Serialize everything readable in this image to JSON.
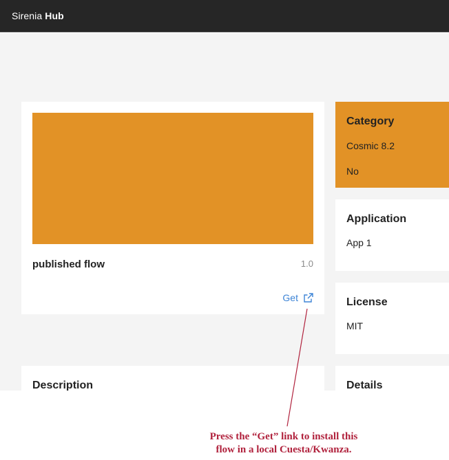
{
  "header": {
    "brand_primary": "Sirenia",
    "brand_secondary": "Hub"
  },
  "flow": {
    "name": "published flow",
    "version": "1.0",
    "get_label": "Get",
    "thumbnail_color": "#e29226"
  },
  "side_cards": {
    "category": {
      "title": "Category",
      "value": "Cosmic 8.2",
      "value2": "No",
      "color": "#e29226"
    },
    "application": {
      "title": "Application",
      "value": "App 1"
    },
    "license": {
      "title": "License",
      "value": "MIT"
    },
    "details": {
      "title": "Details"
    }
  },
  "description": {
    "title": "Description"
  },
  "annotation": {
    "line1": "Press the “Get” link to install this",
    "line2": "flow in a local Cuesta/Kwanza.",
    "color": "#b0213c"
  },
  "icons": {
    "get_link": "external-link-icon"
  }
}
